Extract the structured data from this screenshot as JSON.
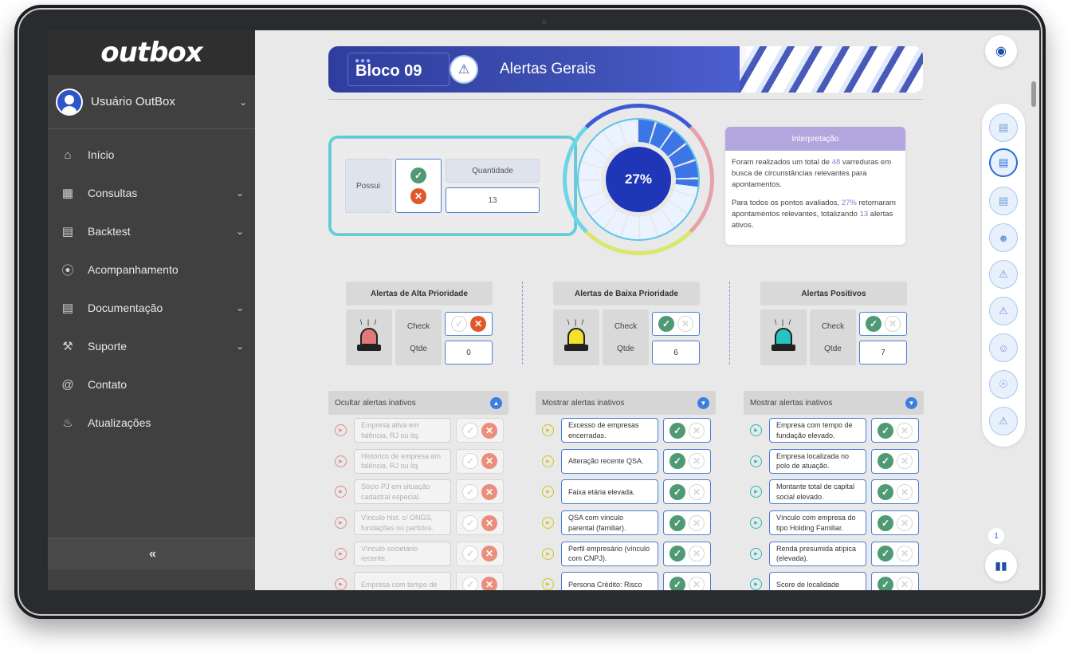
{
  "app": {
    "logo_text": "outbox"
  },
  "user": {
    "name": "Usuário OutBox"
  },
  "sidebar": {
    "items": [
      {
        "label": "Início",
        "icon": "home-icon"
      },
      {
        "label": "Consultas",
        "icon": "grid-icon"
      },
      {
        "label": "Backtest",
        "icon": "ledger-icon"
      },
      {
        "label": "Acompanhamento",
        "icon": "broadcast-icon"
      },
      {
        "label": "Documentação",
        "icon": "book-icon"
      },
      {
        "label": "Suporte",
        "icon": "wrench-icon"
      },
      {
        "label": "Contato",
        "icon": "at-icon"
      },
      {
        "label": "Atualizações",
        "icon": "bell-icon"
      }
    ],
    "collapse_label": "«"
  },
  "header": {
    "block": "Bloco 09",
    "title": "Alertas Gerais"
  },
  "summary": {
    "possui_label": "Possui",
    "quantidade_label": "Quantidade",
    "quantidade_value": "13",
    "percent": "27%",
    "percent_fraction": 0.27
  },
  "interpretation": {
    "title": "Interpretação",
    "p1_a": "Foram realizados um total de ",
    "p1_num": "48",
    "p1_b": " varreduras em busca de circunstâncias relevantes para apontamentos.",
    "p2_a": "Para todos os pontos avaliados, ",
    "p2_pct": "27%",
    "p2_b": " retornaram apontamentos relevantes, totalizando ",
    "p2_num": "13",
    "p2_c": " alertas ativos."
  },
  "groups": [
    {
      "title": "Alertas de Alta Prioridade",
      "check_label": "Check",
      "qty_label": "Qtde",
      "qty": "0",
      "color": "#e07a7a"
    },
    {
      "title": "Alertas de Baixa Prioridade",
      "check_label": "Check",
      "qty_label": "Qtde",
      "qty": "6",
      "color": "#f2e22a"
    },
    {
      "title": "Alertas Positivos",
      "check_label": "Check",
      "qty_label": "Qtde",
      "qty": "7",
      "color": "#26c3c0"
    }
  ],
  "lists": [
    {
      "header": "Ocultar alertas inativos",
      "rows": [
        "Empresa ativa em falência, RJ ou liq.",
        "Histórico de empresa em falência, RJ ou liq.",
        "Sócio PJ em situação cadastral especial.",
        "Vínculo hist. c/ ONGS, fundações ou partidos.",
        "Vínculo societário recente.",
        "Empresa com tempo de"
      ]
    },
    {
      "header": "Mostrar alertas inativos",
      "rows": [
        "Excesso de empresas encerradas.",
        "Alteração recente QSA.",
        "Faixa etária elevada.",
        "QSA com vínculo parental (familiar).",
        "Perfil empresário (vínculo com CNPJ).",
        "Persona Crédito: Risco"
      ]
    },
    {
      "header": "Mostrar alertas inativos",
      "rows": [
        "Empresa com tempo de fundação elevado.",
        "Empresa localizada no polo de atuação.",
        "Montante total de capital social elevado.",
        "Vínculo com empresa do tipo Holding Familiar.",
        "Renda presumida atípica (elevada).",
        "Score de localidade"
      ]
    }
  ],
  "rail": {
    "page_number": "1",
    "icons": [
      "document-icon",
      "chart-doc-icon",
      "report-icon",
      "people-icon",
      "warning-chart-icon",
      "alert-icon",
      "faces-icon",
      "network-icon",
      "warning-search-icon"
    ]
  }
}
